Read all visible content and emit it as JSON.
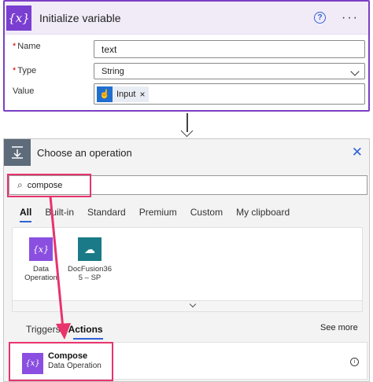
{
  "colors": {
    "variable_purple": "#7a3fd1",
    "highlight_pink": "#e8336d",
    "link_blue": "#2f62d6",
    "operation_gray": "#5d6b7a",
    "docfusion_teal": "#1a7a87"
  },
  "variable_card": {
    "icon_glyph": "{x}",
    "title": "Initialize variable",
    "help_glyph": "?",
    "more_glyph": "···",
    "name": {
      "label": "Name",
      "required_mark": "*",
      "value": "text"
    },
    "type": {
      "label": "Type",
      "required_mark": "*",
      "value": "String"
    },
    "value": {
      "label": "Value",
      "token_label": "Input",
      "token_icon": "hand-icon",
      "token_remove": "×"
    }
  },
  "operation_card": {
    "title": "Choose an operation",
    "close_glyph": "✕",
    "search": {
      "value": "compose",
      "icon": "search-icon"
    },
    "tabs": [
      "All",
      "Built-in",
      "Standard",
      "Premium",
      "Custom",
      "My clipboard"
    ],
    "active_tab": "All",
    "connectors": [
      {
        "label_line1": "Data",
        "label_line2": "Operation",
        "icon_glyph": "{x}"
      },
      {
        "label_line1": "DocFusion36",
        "label_line2": "5 – SP",
        "icon_glyph": "☁"
      }
    ],
    "action_tabs": [
      "Triggers",
      "Actions"
    ],
    "active_action_tab": "Actions",
    "see_more": "See more",
    "actions": [
      {
        "name": "Compose",
        "connector": "Data Operation",
        "icon_glyph": "{x}",
        "info_glyph": "i"
      }
    ]
  }
}
